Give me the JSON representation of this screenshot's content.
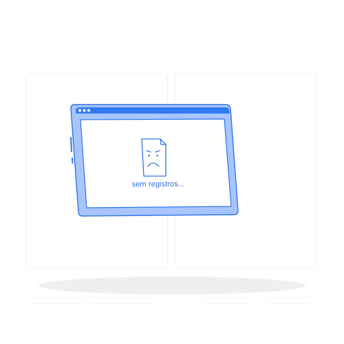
{
  "empty_state": {
    "message": "sem registros...",
    "icon": "sad-document-icon",
    "window_dots": [
      "dot",
      "dot",
      "dot"
    ]
  },
  "colors": {
    "window_frame": "#a7c5ff",
    "window_frame_stroke": "#2f73e5",
    "title_bar": "#3179f0",
    "text_accent": "#2e6fd8",
    "background_card_border": "#f1f1f3",
    "floor_shadow": "#efefef"
  }
}
